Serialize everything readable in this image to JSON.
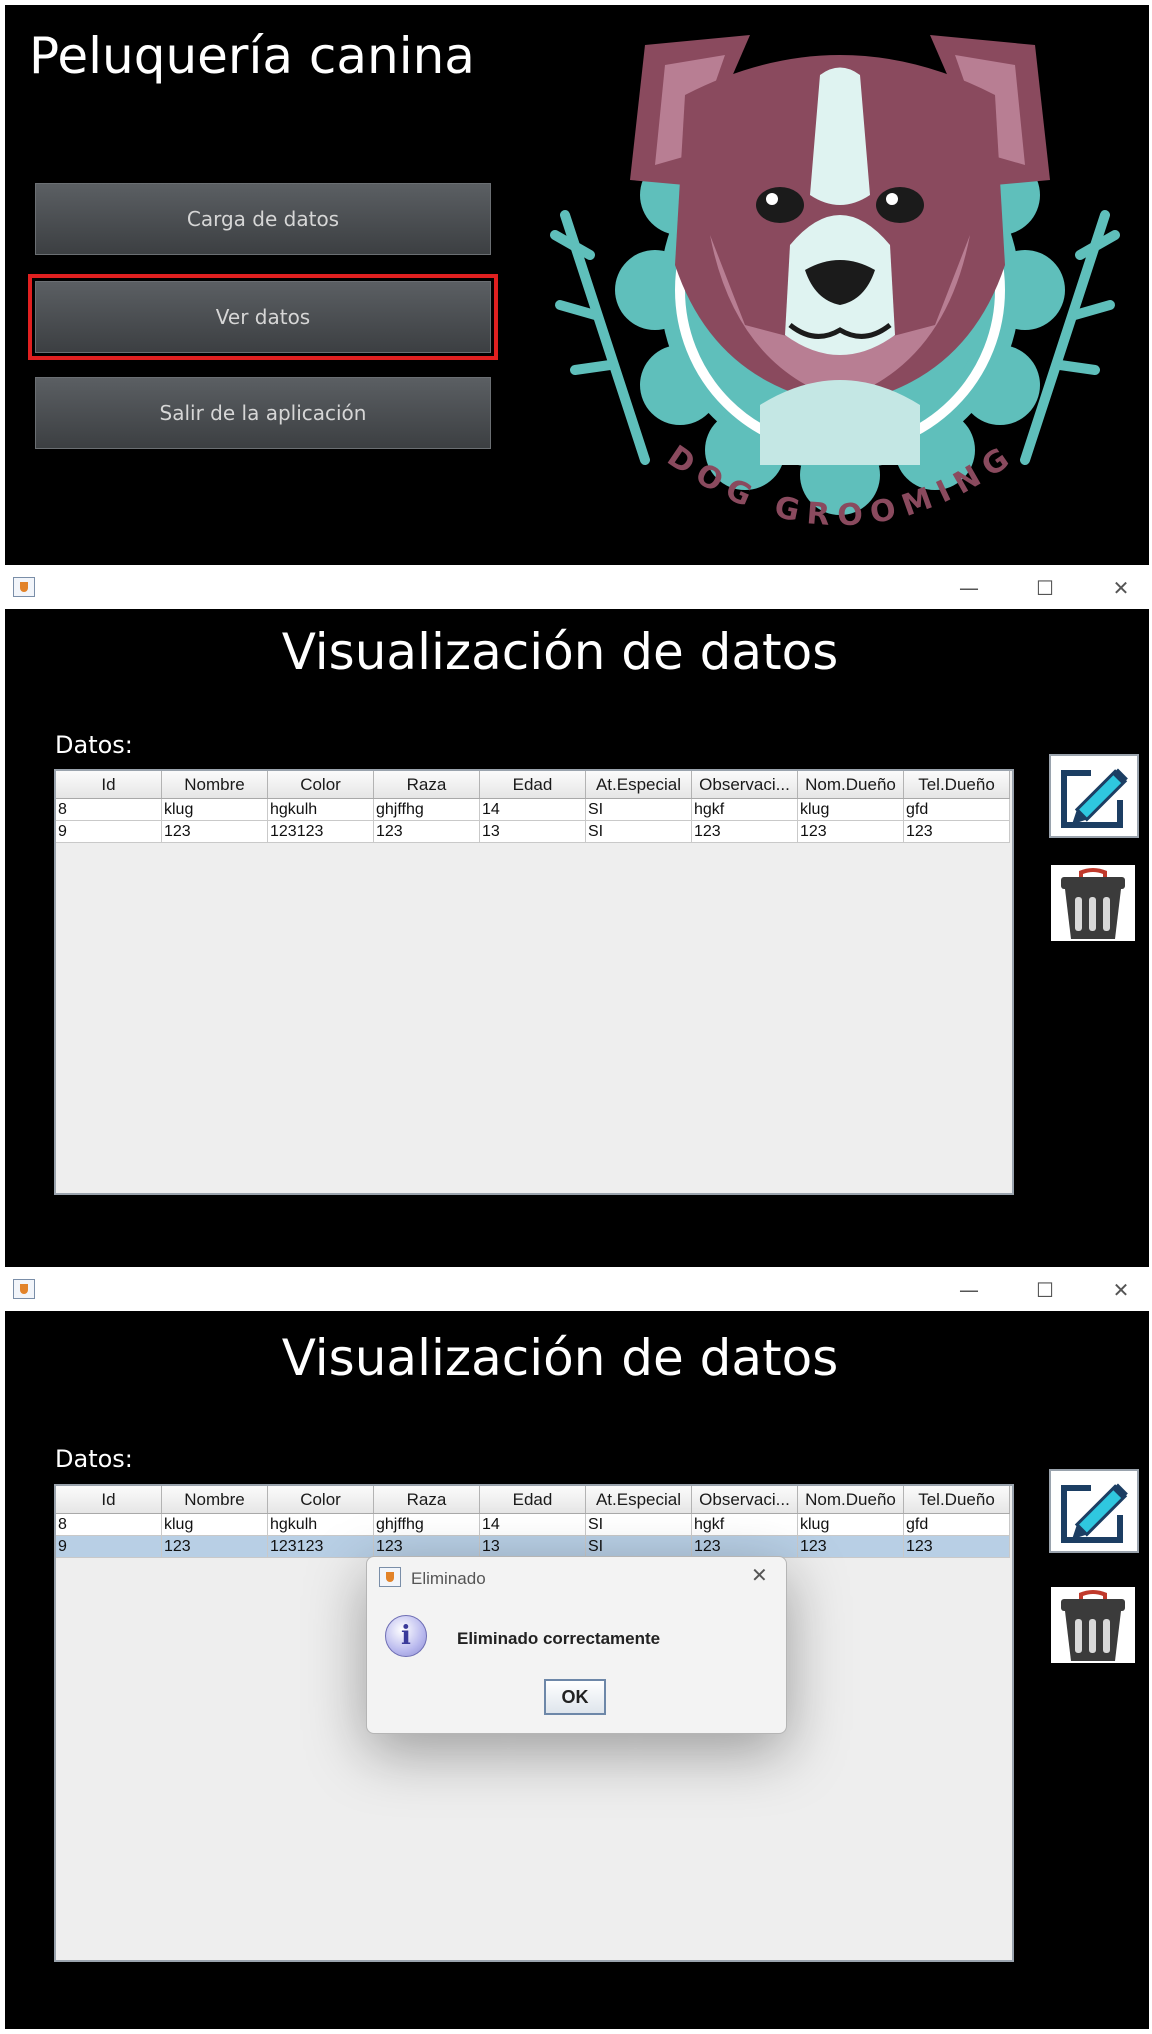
{
  "menu": {
    "title": "Peluquería canina",
    "buttons": [
      "Carga de datos",
      "Ver datos",
      "Salir de la aplicación"
    ],
    "logo_text": "DOG GROOMING"
  },
  "window": {
    "minimize": "—",
    "maximize": "☐",
    "close": "✕"
  },
  "view": {
    "title": "Visualización de datos",
    "datos_label": "Datos:",
    "columns": [
      "Id",
      "Nombre",
      "Color",
      "Raza",
      "Edad",
      "At.Especial",
      "Observaci...",
      "Nom.Dueño",
      "Tel.Dueño"
    ],
    "rows": [
      [
        "8",
        "klug",
        "hgkulh",
        "ghjffhg",
        "14",
        "SI",
        "hgkf",
        "klug",
        "gfd"
      ],
      [
        "9",
        "123",
        "123123",
        "123",
        "13",
        "SI",
        "123",
        "123",
        "123"
      ]
    ],
    "edit_icon": "pencil-edit-icon",
    "delete_icon": "trash-can-icon"
  },
  "dialog": {
    "title": "Eliminado",
    "message": "Eliminado correctamente",
    "ok": "OK",
    "close": "✕",
    "icon": "info-icon"
  },
  "colors": {
    "highlight_border": "#e02020",
    "selected_row": "#b8cfe5",
    "logo_teal": "#5fbfbb",
    "logo_plum": "#8a4a5e"
  }
}
